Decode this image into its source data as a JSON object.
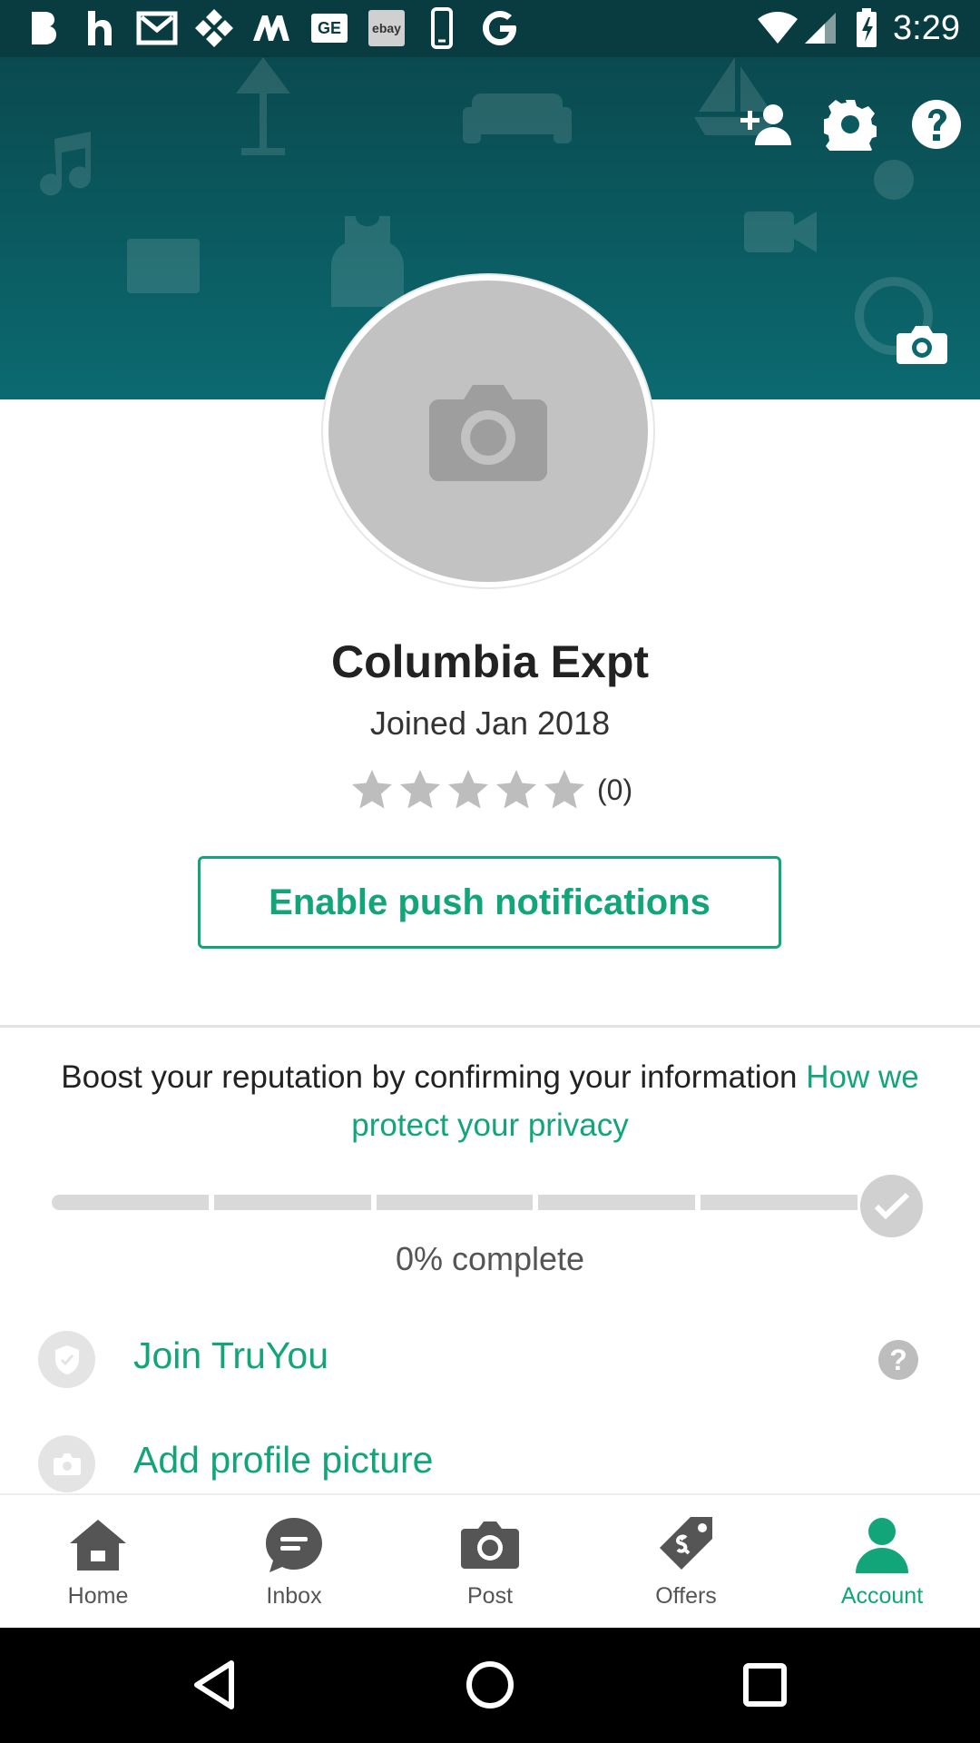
{
  "status_bar": {
    "time": "3:29",
    "notification_icons": [
      "b-icon",
      "h-icon",
      "mail-icon",
      "four-square-icon",
      "m-icon",
      "ge-icon",
      "ebay-icon",
      "phone-icon",
      "g-icon"
    ],
    "ebay_text": "ebay",
    "ge_text": "GE",
    "status_icons": [
      "wifi-icon",
      "signal-icon",
      "battery-charging-icon"
    ]
  },
  "header": {
    "action_icons": [
      "add-person-icon",
      "gear-icon",
      "help-icon"
    ],
    "cover_camera_icon": "camera-icon"
  },
  "profile": {
    "name": "Columbia Expt",
    "joined": "Joined Jan 2018",
    "rating_stars": 0,
    "rating_max": 5,
    "rating_count": "(0)",
    "push_button": "Enable push notifications"
  },
  "reputation": {
    "text": "Boost your reputation by confirming your information",
    "privacy_link": "How we protect your privacy",
    "progress_fraction": 0,
    "progress_segments": 5,
    "progress_text": "0% complete",
    "tasks": [
      {
        "label": "Join TruYou",
        "icon": "shield-check-icon",
        "help": "?"
      },
      {
        "label": "Add profile picture",
        "icon": "camera-icon"
      }
    ]
  },
  "bottom_nav": {
    "items": [
      {
        "label": "Home",
        "icon": "home-icon"
      },
      {
        "label": "Inbox",
        "icon": "chat-bubble-icon"
      },
      {
        "label": "Post",
        "icon": "camera-icon"
      },
      {
        "label": "Offers",
        "icon": "price-tag-icon"
      },
      {
        "label": "Account",
        "icon": "person-icon"
      }
    ],
    "active": "Account"
  },
  "colors": {
    "accent": "#12a57a",
    "header_dark": "#0a4a4f",
    "header_light": "#0b6a70",
    "status_bar": "#083c40"
  }
}
